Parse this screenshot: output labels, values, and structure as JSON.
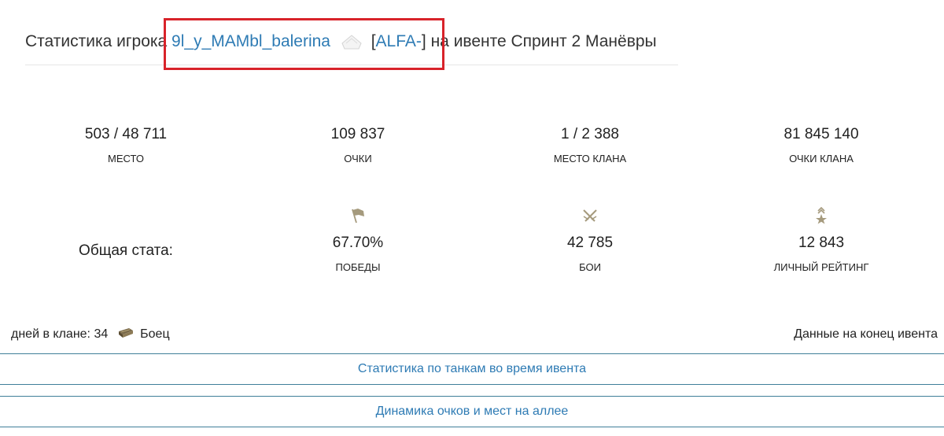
{
  "header": {
    "prefix": "Статистика игрока",
    "player_name": "9l_y_MAMbl_balerina",
    "clan_tag": "ALFA-",
    "bracket_open": "[",
    "bracket_close": "]",
    "suffix": "на ивенте Спринт 2 Манёвры"
  },
  "stats_row1": [
    {
      "value": "503 / 48 711",
      "label": "МЕСТО"
    },
    {
      "value": "109 837",
      "label": "ОЧКИ"
    },
    {
      "value": "1 / 2 388",
      "label": "МЕСТО КЛАНА"
    },
    {
      "value": "81 845 140",
      "label": "ОЧКИ КЛАНА"
    }
  ],
  "overall": {
    "label": "Общая стата:",
    "items": [
      {
        "icon": "flag-icon",
        "value": "67.70%",
        "label": "ПОБЕДЫ"
      },
      {
        "icon": "crossed-swords-icon",
        "value": "42 785",
        "label": "БОИ"
      },
      {
        "icon": "rank-star-icon",
        "value": "12 843",
        "label": "ЛИЧНЫЙ РЕЙТИНГ"
      }
    ]
  },
  "footer": {
    "days_in_clan": "дней в клане: 34",
    "role": "Боец",
    "data_end": "Данные на конец ивента"
  },
  "accordion": [
    {
      "label": "Статистика по танкам во время ивента"
    },
    {
      "label": "Динамика очков и мест на аллее"
    }
  ],
  "colors": {
    "link": "#2e7bb4",
    "highlight": "#d8232a",
    "divider": "#3f7f99",
    "icon": "#a59a7d"
  }
}
